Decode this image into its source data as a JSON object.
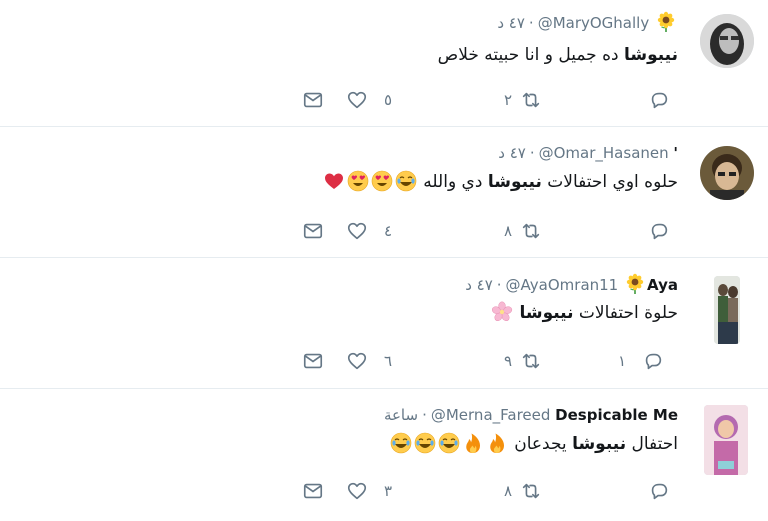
{
  "tweets": [
    {
      "name": "",
      "name_emoji": "sunflower",
      "handle": "@MaryOGhally",
      "dot": "·",
      "time": "٤٧ د",
      "text_before": "",
      "bold": "نيبوشا",
      "text_after": " ده جميل و انا حبيته خلاص",
      "emojis": [],
      "retweets": "٢",
      "likes": "٥"
    },
    {
      "name": "'",
      "name_emoji": "",
      "handle": "@Omar_Hasanen",
      "dot": "·",
      "time": "٤٧ د",
      "text_before": "حلوه اوي احتفالات ",
      "bold": "نيبوشا",
      "text_after": " دي والله ",
      "emojis": [
        "joy",
        "heart-eyes",
        "heart-eyes",
        "red-heart"
      ],
      "retweets": "٨",
      "likes": "٤"
    },
    {
      "name": "Aya",
      "name_emoji": "sunflower",
      "handle": "@AyaOmran11",
      "dot": "·",
      "time": "٤٧ د",
      "text_before": "حلوة احتفالات ",
      "bold": "نيبوشا",
      "text_after": " ",
      "emojis": [
        "cherry-blossom"
      ],
      "retweets": "٩",
      "likes": "٦",
      "replies": "١"
    },
    {
      "name": "Despicable Me",
      "name_emoji": "",
      "handle": "@Merna_Fareed",
      "dot": "·",
      "time": "ساعة",
      "text_before": "احتفال ",
      "bold": "نيبوشا",
      "text_after": " يجدعان ",
      "emojis": [
        "fire",
        "fire",
        "joy",
        "joy",
        "joy"
      ],
      "retweets": "٨",
      "likes": "٣"
    }
  ],
  "colors": {
    "muted": "#657786",
    "divider": "#e6ecf0",
    "text": "#14171a"
  },
  "icons": [
    "reply-icon",
    "retweet-icon",
    "like-icon",
    "dm-icon"
  ]
}
